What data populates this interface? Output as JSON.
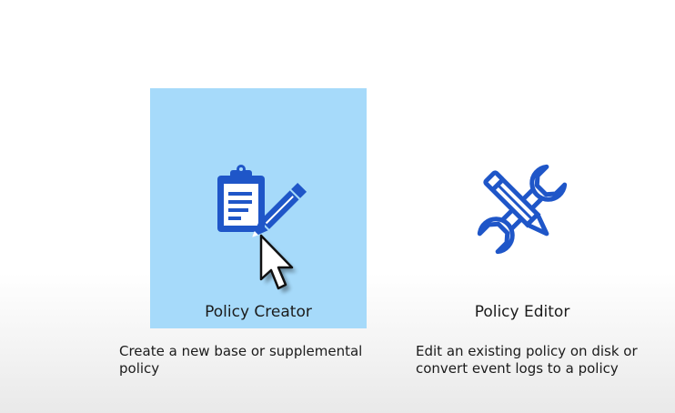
{
  "tiles": [
    {
      "label": "Policy Creator",
      "icon": "clipboard-pencil-icon",
      "selected": true,
      "description": [
        "Create a new base or supplemental",
        "policy"
      ]
    },
    {
      "label": "Policy Editor",
      "icon": "wrench-pencil-icon",
      "selected": false,
      "description": [
        "Edit an existing policy on disk or",
        "convert event logs to a policy"
      ]
    }
  ],
  "colors": {
    "selected_tile_bg": "#a6dafa",
    "icon_blue": "#1f56c8"
  }
}
